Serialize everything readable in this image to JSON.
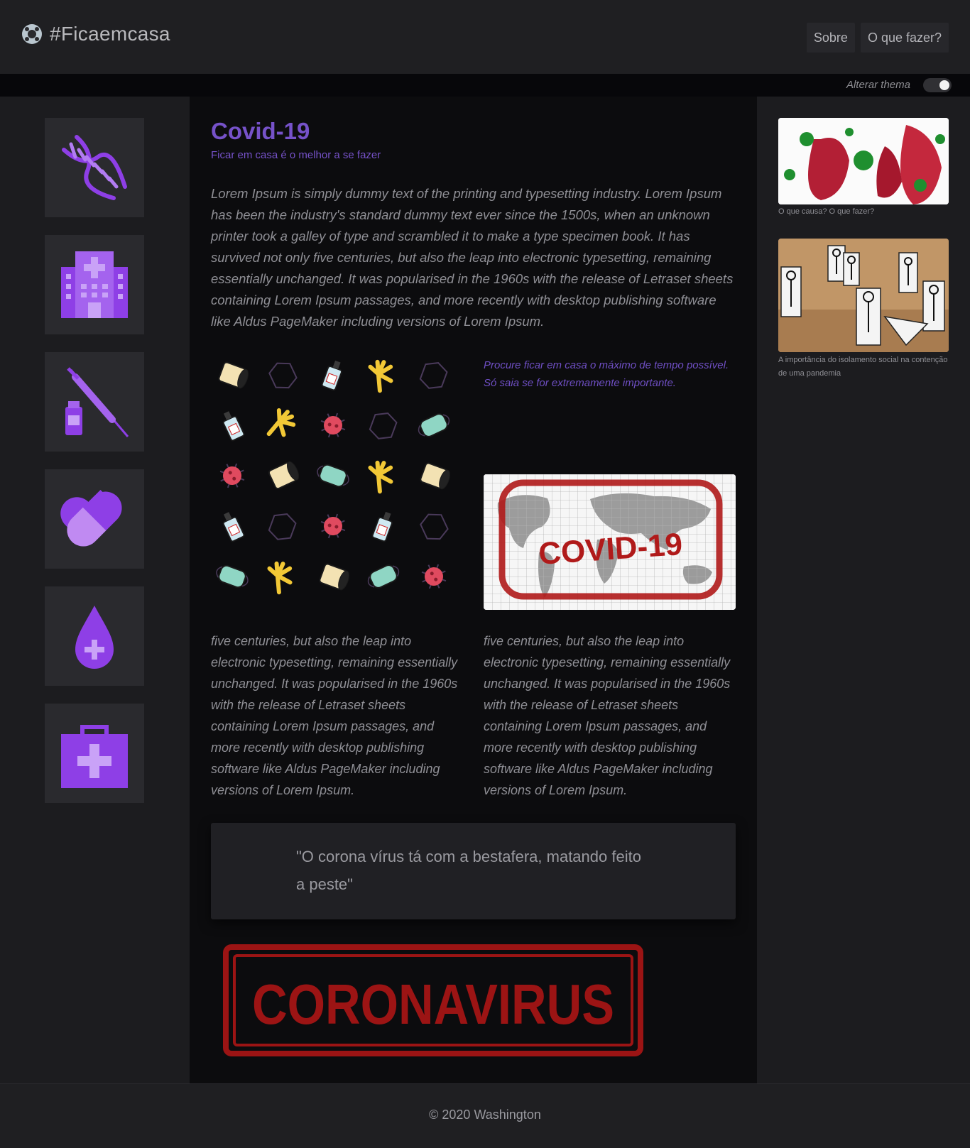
{
  "header": {
    "brand": "#Ficaemcasa",
    "brand_icon": "virus-icon",
    "nav": [
      "Sobre",
      "O que fazer?"
    ]
  },
  "theme_toggle": {
    "label": "Alterar thema",
    "state": "on"
  },
  "left_sidebar": {
    "icons": [
      "dna-icon",
      "hospital-icon",
      "syringe-icon",
      "pill-icon",
      "blood-drop-icon",
      "first-aid-kit-icon"
    ],
    "accent": "#8a2be2"
  },
  "main": {
    "title": "Covid-19",
    "subtitle": "Ficar em casa é o melhor a se fazer",
    "intro": "Lorem Ipsum is simply dummy text of the printing and typesetting industry. Lorem Ipsum has been the industry's standard dummy text ever since the 1500s, when an unknown printer took a galley of type and scrambled it to make a type specimen book. It has survived not only five centuries, but also the leap into electronic typesetting, remaining essentially unchanged. It was popularised in the 1960s with the release of Letraset sheets containing Lorem Ipsum passages, and more recently with desktop publishing software like Aldus PageMaker including versions of Lorem Ipsum.",
    "side_note": "Procure ficar em casa o máximo de tempo possível. Só saia se for extremamente importante.",
    "covid_stamp_text": "COVID-19",
    "column_1": "five centuries, but also the leap into electronic typesetting, remaining essentially unchanged. It was popularised in the 1960s with the release of Letraset sheets containing Lorem Ipsum passages, and more recently with desktop publishing software like Aldus PageMaker including versions of Lorem Ipsum.",
    "column_2": "five centuries, but also the leap into electronic typesetting, remaining essentially unchanged. It was popularised in the 1960s with the release of Letraset sheets containing Lorem Ipsum passages, and more recently with desktop publishing software like Aldus PageMaker including versions of Lorem Ipsum.",
    "quote": "\"O corona vírus tá com a bestafera, matando feito a peste\"",
    "banner_text": "CORONAVIRUS",
    "title_color": "#7652c9",
    "stamp_color": "#b01a1a"
  },
  "right_sidebar": {
    "items": [
      {
        "caption": "O que causa? O que fazer?"
      },
      {
        "caption": "A importância do isolamento social na contenção de uma pandemia"
      }
    ]
  },
  "footer": {
    "text": "© 2020 Washington"
  }
}
